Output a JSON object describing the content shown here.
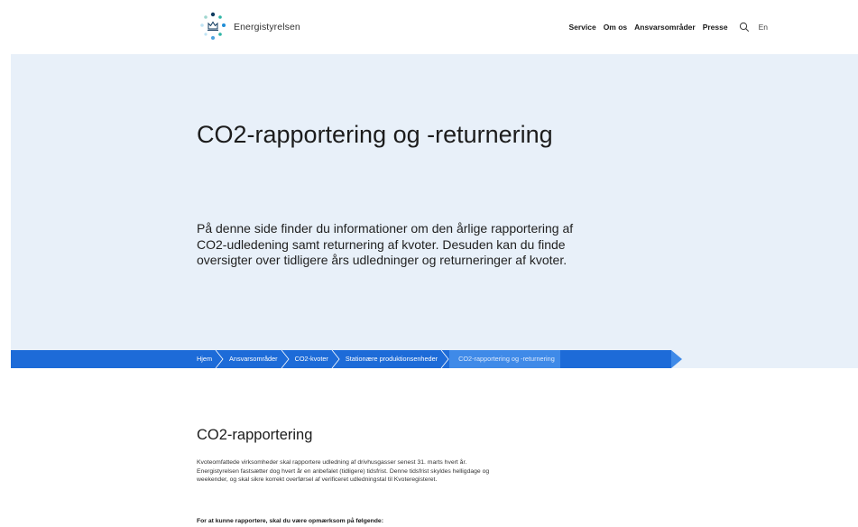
{
  "header": {
    "logo_text": "Energistyrelsen",
    "nav": [
      "Service",
      "Om os",
      "Ansvarsområder",
      "Presse"
    ],
    "lang": "En"
  },
  "hero": {
    "title": "CO2-rapportering og -returnering",
    "lead": "På denne side finder du informationer om den årlige rapportering af CO2-udledening samt returnering af kvoter. Desuden kan du finde oversigter over tidligere års udledninger og returneringer af kvoter."
  },
  "breadcrumb": {
    "items": [
      "Hjem",
      "Ansvarsområder",
      "CO2-kvoter",
      "Stationære produktionsenheder"
    ],
    "current": "CO2-rapportering og -returnering"
  },
  "content": {
    "title": "CO2-rapportering",
    "body": "Kvoteomfattede virksomheder skal rapportere udledning af drivhusgasser senest 31. marts hvert år. Energistyrelsen fastsætter dog hvert år en anbefalet (tidligere) tidsfrist. Denne tidsfrist skyldes helligdage og weekender, og skal sikre korrekt overførsel af verificeret udledningstal til Kvoteregisteret.",
    "strong": "For at kunne rapportere, skal du være opmærksom på følgende:"
  },
  "colors": {
    "hero_bg": "#e8f0f9",
    "breadcrumb_bar": "#1d6bd8",
    "breadcrumb_current": "#3f8ae8",
    "logo_teal": "#2fb5a6",
    "logo_blue": "#4aa3df",
    "logo_navy": "#0f3a5f"
  }
}
